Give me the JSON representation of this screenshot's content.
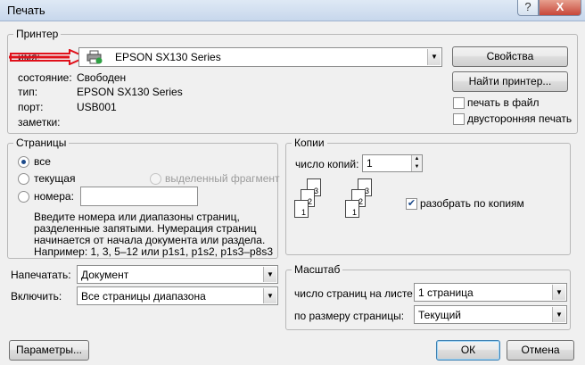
{
  "window": {
    "title": "Печать",
    "help_label": "?",
    "close_label": "X"
  },
  "printer": {
    "legend": "Принтер",
    "name_label": "имя:",
    "name_value": "EPSON SX130 Series",
    "status_label": "состояние:",
    "status_value": "Свободен",
    "type_label": "тип:",
    "type_value": "EPSON SX130 Series",
    "port_label": "порт:",
    "port_value": "USB001",
    "notes_label": "заметки:",
    "properties_button": "Свойства",
    "find_button": "Найти принтер...",
    "print_to_file": "печать в файл",
    "duplex": "двусторонняя печать"
  },
  "pages": {
    "legend": "Страницы",
    "all": "все",
    "current": "текущая",
    "selection": "выделенный фрагмент",
    "numbers": "номера:",
    "hint_lines": [
      "Введите номера или диапазоны страниц,",
      "разделенные запятыми. Нумерация страниц",
      "начинается от начала документа или раздела.",
      "Например: 1, 3, 5–12 или p1s1, p1s2, p1s3–p8s3"
    ]
  },
  "copies": {
    "legend": "Копии",
    "count_label": "число копий:",
    "count_value": "1",
    "collate": "разобрать по копиям",
    "collate_checked": true
  },
  "print_what": {
    "label": "Напечатать:",
    "value": "Документ"
  },
  "include": {
    "label": "Включить:",
    "value": "Все страницы диапазона"
  },
  "zoom": {
    "legend": "Масштаб",
    "pages_per_sheet_label": "число страниц на листе:",
    "pages_per_sheet_value": "1 страница",
    "scale_label": "по размеру страницы:",
    "scale_value": "Текущий"
  },
  "buttons": {
    "options": "Параметры...",
    "ok": "ОК",
    "cancel": "Отмена"
  },
  "colors": {
    "arrow": "#e0101a"
  }
}
